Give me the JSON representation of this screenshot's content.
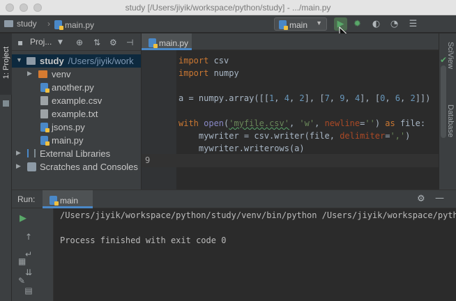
{
  "window": {
    "title": "study [/Users/jiyik/workspace/python/study] - .../main.py"
  },
  "navbar": {
    "project_crumb": "study",
    "file_crumb": "main.py",
    "run_config": "main",
    "toolbar_icons": [
      "run-icon",
      "debug-icon",
      "coverage-icon",
      "profile-icon",
      "concurrency-icon"
    ]
  },
  "left_strip": {
    "project_tab": "1: Project"
  },
  "project_panel": {
    "header_label": "Proj...",
    "tree": [
      {
        "label": "study",
        "path": "/Users/jiyik/work",
        "type": "folder",
        "expanded": true
      },
      {
        "label": "venv",
        "type": "folder-excluded",
        "expanded": false
      },
      {
        "label": "another.py",
        "type": "python"
      },
      {
        "label": "example.csv",
        "type": "text"
      },
      {
        "label": "example.txt",
        "type": "text"
      },
      {
        "label": "jsons.py",
        "type": "python"
      },
      {
        "label": "main.py",
        "type": "python"
      },
      {
        "label": "External Libraries",
        "type": "library",
        "expanded": false
      },
      {
        "label": "Scratches and Consoles",
        "type": "scratch",
        "expanded": false
      }
    ]
  },
  "editor": {
    "tab_label": "main.py",
    "caret_line_number": "9",
    "code": {
      "line1_kw": "import",
      "line1_mod": " csv",
      "line2_kw": "import",
      "line2_mod": " numpy",
      "line4_a": "a = numpy.array([[",
      "line4_n1": "1",
      "line4_s1": ", ",
      "line4_n2": "4",
      "line4_s2": ", ",
      "line4_n3": "2",
      "line4_s3": "], [",
      "line4_n4": "7",
      "line4_s4": ", ",
      "line4_n5": "9",
      "line4_s5": ", ",
      "line4_n6": "4",
      "line4_s6": "], [",
      "line4_n7": "0",
      "line4_s7": ", ",
      "line4_n8": "6",
      "line4_s8": ", ",
      "line4_n9": "2",
      "line4_end": "]])",
      "line6_kw": "with",
      "line6_fn": " open",
      "line6_p1": "(",
      "line6_str1": "'myfile.csv'",
      "line6_p2": ", ",
      "line6_str2": "'w'",
      "line6_p3": ", ",
      "line6_param": "newline",
      "line6_p4": "=",
      "line6_str3": "''",
      "line6_p5": ") ",
      "line6_as": "as",
      "line6_end": " file:",
      "line7_a": "    mywriter = csv.writer(file, ",
      "line7_param": "delimiter",
      "line7_eq": "=",
      "line7_str": "','",
      "line7_end": ")",
      "line8": "    mywriter.writerows(a)"
    },
    "right_tool_labels": [
      "SciView",
      "Database"
    ]
  },
  "run_panel": {
    "label": "Run:",
    "tab_label": "main",
    "console": {
      "command": "/Users/jiyik/workspace/python/study/venv/bin/python /Users/jiyik/workspace/pytho",
      "result": "Process finished with exit code 0"
    }
  },
  "colors": {
    "background": "#2b2b2b",
    "panel": "#3c3f41",
    "keyword": "#cc7832",
    "string": "#6a8759",
    "number": "#6897bb",
    "parameter": "#aa4926",
    "run_green": "#59a869",
    "selection": "#0d293e"
  }
}
